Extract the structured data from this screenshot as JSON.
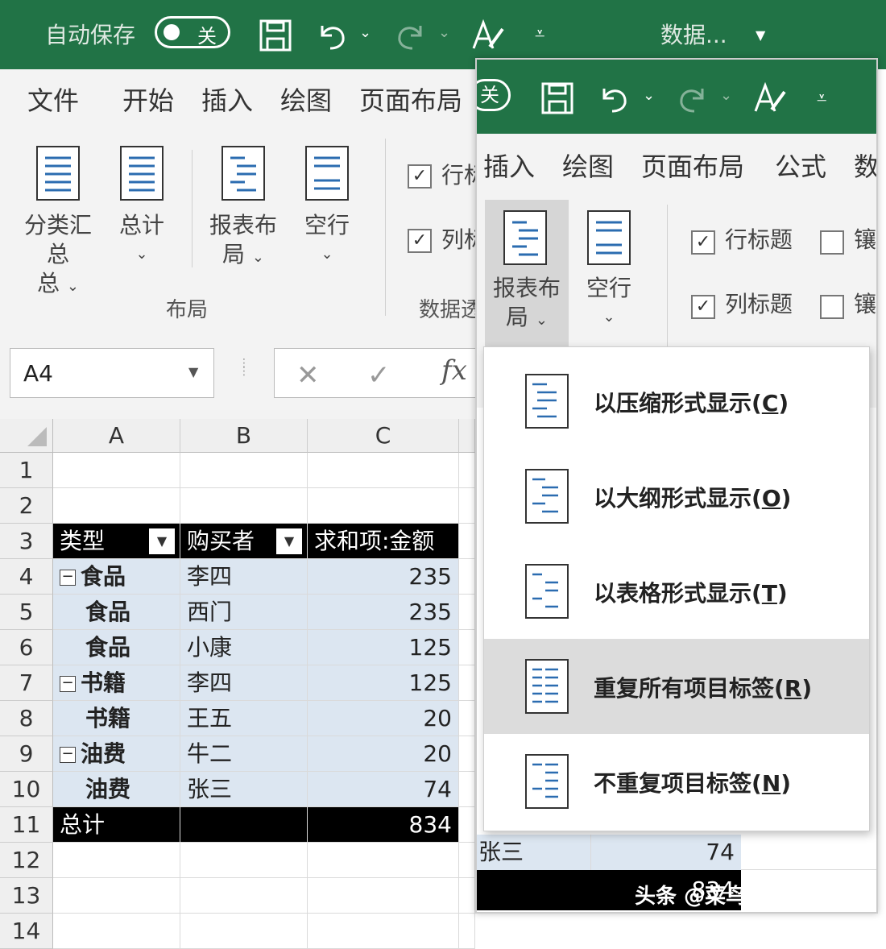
{
  "qat": {
    "autosave_label": "自动保存",
    "autosave_state": "关",
    "data_label": "数据..."
  },
  "tabs": [
    "文件",
    "开始",
    "插入",
    "绘图",
    "页面布局"
  ],
  "ribbon": {
    "subtotal_label": "分类汇总",
    "subtotal_label2": "总",
    "grandtotal_label": "总计",
    "report_layout_label": "报表布",
    "report_layout_label2": "局",
    "blank_rows_label": "空行",
    "layout_group": "布局",
    "row_headers_label": "行标题",
    "col_headers_label": "列标题",
    "style_options_group": "数据透",
    "row_partial": "行标",
    "col_partial": "列标"
  },
  "namebox": "A4",
  "formula_prefix": "fx",
  "columns": [
    "A",
    "B",
    "C"
  ],
  "rows": [
    "1",
    "2",
    "3",
    "4",
    "5",
    "6",
    "7",
    "8",
    "9",
    "10",
    "11",
    "12",
    "13",
    "14"
  ],
  "pivot": {
    "headers": [
      "类型",
      "购买者",
      "求和项:金额"
    ],
    "data": [
      {
        "type": "食品",
        "buyer": "李四",
        "amount": "235",
        "collapse": true
      },
      {
        "type": "食品",
        "buyer": "西门",
        "amount": "235",
        "collapse": false
      },
      {
        "type": "食品",
        "buyer": "小康",
        "amount": "125",
        "collapse": false
      },
      {
        "type": "书籍",
        "buyer": "李四",
        "amount": "125",
        "collapse": true
      },
      {
        "type": "书籍",
        "buyer": "王五",
        "amount": "20",
        "collapse": false
      },
      {
        "type": "油费",
        "buyer": "牛二",
        "amount": "20",
        "collapse": true
      },
      {
        "type": "油费",
        "buyer": "张三",
        "amount": "74",
        "collapse": false
      }
    ],
    "total_label": "总计",
    "total_value": "834"
  },
  "win2": {
    "autosave_state": "关",
    "tabs": [
      "插入",
      "绘图",
      "页面布局",
      "公式",
      "数"
    ],
    "report_layout_label": "报表布",
    "report_layout_label2": "局",
    "blank_rows_label": "空行",
    "row_headers_label": "行标题",
    "col_headers_label": "列标题",
    "banded_rows_label": "镶",
    "banded_cols_label": "镶",
    "bottom_cell": "张三",
    "bottom_value": "74",
    "bottom_total": "834"
  },
  "menu": [
    {
      "text": "以压缩形式显示(",
      "key": "C",
      "end": ")"
    },
    {
      "text": "以大纲形式显示(",
      "key": "O",
      "end": ")"
    },
    {
      "text": "以表格形式显示(",
      "key": "T",
      "end": ")"
    },
    {
      "text": "重复所有项目标签(",
      "key": "R",
      "end": ")"
    },
    {
      "text": "不重复项目标签(",
      "key": "N",
      "end": ")"
    }
  ],
  "watermark": "头条 @菜鸟学数据分析",
  "colors": {
    "excel_green": "#217346",
    "pivot_fill": "#dce6f1",
    "menu_hover": "#dcdcdc"
  }
}
